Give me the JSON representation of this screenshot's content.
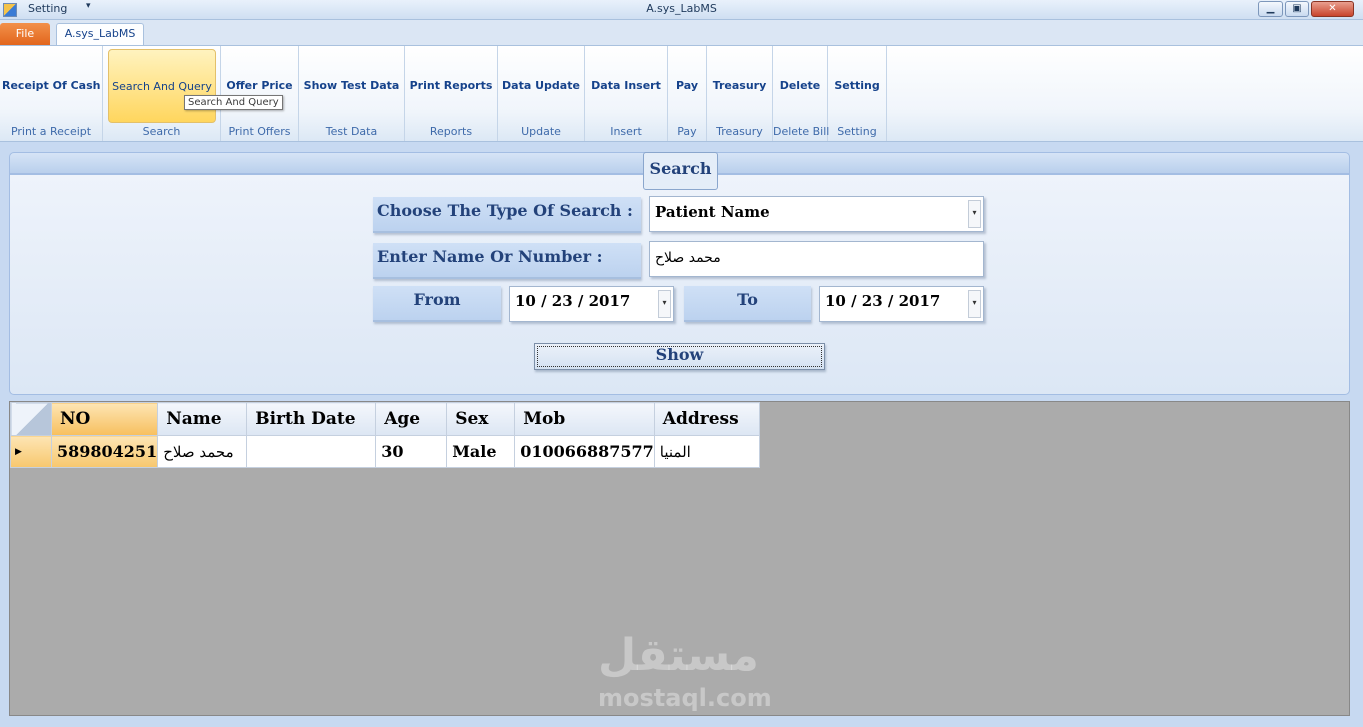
{
  "titlebar": {
    "quick_access": "Setting",
    "qa_arrow": "▾",
    "title": "A.sys_LabMS",
    "min": "▁",
    "max": "▣",
    "close": "✕"
  },
  "tabs": {
    "file": "File",
    "main": "A.sys_LabMS"
  },
  "ribbon": [
    {
      "button": "Receipt Of Cash",
      "group": "Print a Receipt"
    },
    {
      "button": "Search And Query",
      "group": "Search"
    },
    {
      "button": "Offer Price",
      "group": "Print Offers"
    },
    {
      "button": "Show Test Data",
      "group": "Test Data"
    },
    {
      "button": "Print Reports",
      "group": "Reports"
    },
    {
      "button": "Data Update",
      "group": "Update"
    },
    {
      "button": "Data Insert",
      "group": "Insert"
    },
    {
      "button": "Pay",
      "group": "Pay"
    },
    {
      "button": "Treasury",
      "group": "Treasury"
    },
    {
      "button": "Delete",
      "group": "Delete Bill"
    },
    {
      "button": "Setting",
      "group": "Setting"
    }
  ],
  "tooltip": "Search And Query",
  "search": {
    "title": "Search",
    "type_label": "Choose The Type Of Search :",
    "type_value": "Patient Name",
    "name_label": "Enter Name Or Number :",
    "name_value": "محمد صلاح",
    "from_label": "From",
    "from_value": "10 / 23 / 2017",
    "to_label": "To",
    "to_value": "10 / 23 / 2017",
    "show_label": "Show",
    "dropdown_glyph": "▾"
  },
  "grid": {
    "columns": [
      "NO",
      "Name",
      "Birth Date",
      "Age",
      "Sex",
      "Mob",
      "Address"
    ],
    "row_marker": "▶",
    "rows": [
      [
        "589804251",
        "محمد صلاح",
        "",
        "30",
        "Male",
        "010066887577",
        "المنيا"
      ]
    ]
  },
  "watermark": {
    "arabic": "مستقل",
    "latin": "mostaql.com"
  }
}
